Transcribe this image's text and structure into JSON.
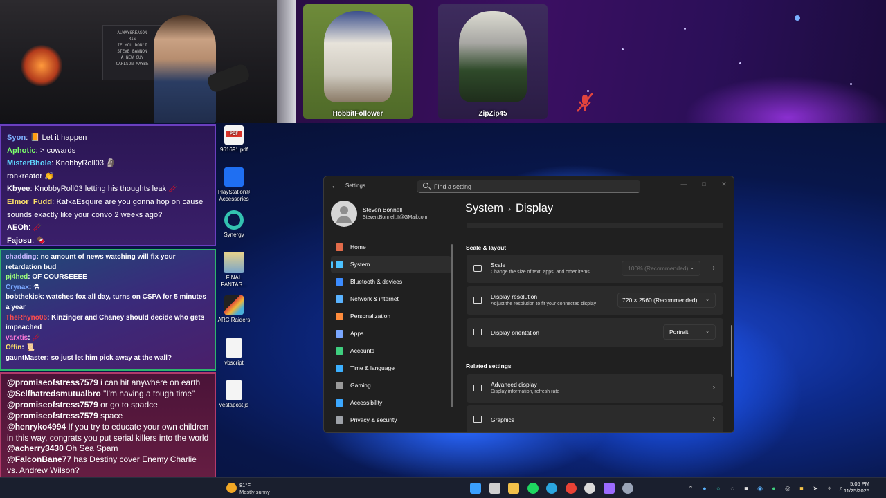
{
  "stream": {
    "webcam_sign_lines": [
      "ALWAYSREASON",
      "RIS",
      "IF YOU DON'T",
      "STEVE BANNON",
      "A NEW GUY",
      "CARLSON MAYBE"
    ],
    "call_participants": [
      {
        "name": "HobbitFollower"
      },
      {
        "name": "ZipZip45",
        "muted": true
      }
    ]
  },
  "chat_panel_1": [
    {
      "user": "Syon",
      "user_color": "#7fb2ff",
      "text": "📙 Let it happen"
    },
    {
      "user": "Aphotic",
      "user_color": "#7cff6a",
      "text": "> cowards"
    },
    {
      "user": "MisterBhole",
      "user_color": "#5fd7ff",
      "text": "KnobbyRoll03 🗿"
    },
    {
      "user": "",
      "user_color": "#ffffff",
      "text": "ronkreator 👏"
    },
    {
      "user": "Kbyee",
      "user_color": "#ffffff",
      "text": "KnobbyRoll03 letting his thoughts leak 🥢"
    },
    {
      "user": "Elmor_Fudd",
      "user_color": "#ffe36a",
      "text": "KafkaEsquire are you gonna hop on cause"
    },
    {
      "user": "",
      "user_color": "#ffffff",
      "text": "sounds exactly like your convo 2 weeks ago?"
    },
    {
      "user": "AEOh",
      "user_color": "#ffffff",
      "text": "🥢"
    },
    {
      "user": "Fajosu",
      "user_color": "#ffffff",
      "text": "🍫"
    }
  ],
  "chat_panel_2": [
    {
      "user": "chadding",
      "user_color": "#c8b6ff",
      "text": "no amount of news watching will fix your retardation bud"
    },
    {
      "user": "pj4hed",
      "user_color": "#9cff7a",
      "text": "OF COURSEEEE"
    },
    {
      "user": "Crynax",
      "user_color": "#7aa8ff",
      "text": "⚗"
    },
    {
      "user": "bobthekick",
      "user_color": "#ffffff",
      "text": "watches fox all day, turns on CSPA for 5 minutes a year"
    },
    {
      "user": "TheRhyno06",
      "user_color": "#ff4d4d",
      "text": "Kinzinger and Chaney should decide who gets impeached"
    },
    {
      "user": "varxtis",
      "user_color": "#ff7ad9",
      "text": "🥢"
    },
    {
      "user": "Offin",
      "user_color": "#ffe36a",
      "text": "📜"
    },
    {
      "user": "gauntMaster",
      "user_color": "#ffffff",
      "text": "so just let him pick away at the wall?"
    }
  ],
  "chat_panel_3": [
    {
      "user": "@promiseofstress7579",
      "text": "i can hit anywhere on earth"
    },
    {
      "user": "@Selfhatredsmutualbro",
      "text": "\"I'm having a tough time\""
    },
    {
      "user": "@promiseofstress7579",
      "text": "or go to spadce"
    },
    {
      "user": "@promiseofstress7579",
      "text": "space"
    },
    {
      "user": "@henryko4994",
      "text": "If you try to educate your own children in this way, congrats you put serial killers into the world"
    },
    {
      "user": "@acherry3430",
      "text": "Oh Sea Spam"
    },
    {
      "user": "@FalconBane77",
      "text": "has Destiny cover Enemy Charlie vs. Andrew Wilson?"
    }
  ],
  "desktop_icons": [
    {
      "label": "961691.pdf",
      "icon": "pdf-file-icon"
    },
    {
      "label": "PlayStation® Accessories",
      "icon": "playstation-icon"
    },
    {
      "label": "Synergy",
      "icon": "synergy-icon"
    },
    {
      "label": "FINAL FANTAS...",
      "icon": "final-fantasy-icon"
    },
    {
      "label": "ARC Raiders",
      "icon": "arc-raiders-icon"
    },
    {
      "label": "vbscript",
      "icon": "file-icon"
    },
    {
      "label": "vestapost.js",
      "icon": "file-icon"
    }
  ],
  "settings": {
    "app_title": "Settings",
    "search_placeholder": "Find a setting",
    "user_name": "Steven Bonnell",
    "user_email": "Steven.Bonnell.II@GMail.com",
    "breadcrumb_parent": "System",
    "breadcrumb_current": "Display",
    "nav": [
      {
        "label": "Home",
        "icon": "home-icon",
        "color": "#e26b4a",
        "active": false
      },
      {
        "label": "System",
        "icon": "monitor-icon",
        "color": "#4cc2ff",
        "active": true
      },
      {
        "label": "Bluetooth & devices",
        "icon": "bluetooth-icon",
        "color": "#3c8cff",
        "active": false
      },
      {
        "label": "Network & internet",
        "icon": "wifi-icon",
        "color": "#5ab3ff",
        "active": false
      },
      {
        "label": "Personalization",
        "icon": "brush-icon",
        "color": "#ff8c3c",
        "active": false
      },
      {
        "label": "Apps",
        "icon": "apps-icon",
        "color": "#7aa7ff",
        "active": false
      },
      {
        "label": "Accounts",
        "icon": "person-icon",
        "color": "#3fcf7f",
        "active": false
      },
      {
        "label": "Time & language",
        "icon": "globe-clock-icon",
        "color": "#3cb0ff",
        "active": false
      },
      {
        "label": "Gaming",
        "icon": "controller-icon",
        "color": "#9a9a9a",
        "active": false
      },
      {
        "label": "Accessibility",
        "icon": "accessibility-icon",
        "color": "#3ca8ff",
        "active": false
      },
      {
        "label": "Privacy & security",
        "icon": "shield-icon",
        "color": "#9ea2a8",
        "active": false
      }
    ],
    "scale_layout_heading": "Scale & layout",
    "scale_title": "Scale",
    "scale_subtitle": "Change the size of text, apps, and other items",
    "scale_value": "100% (Recommended)",
    "resolution_title": "Display resolution",
    "resolution_subtitle": "Adjust the resolution to fit your connected display",
    "resolution_value": "720 × 2560 (Recommended)",
    "orientation_title": "Display orientation",
    "orientation_value": "Portrait",
    "related_heading": "Related settings",
    "advanced_title": "Advanced display",
    "advanced_subtitle": "Display information, refresh rate",
    "graphics_title": "Graphics"
  },
  "taskbar": {
    "weather_temp": "81°F",
    "weather_desc": "Mostly sunny",
    "time": "5:05 PM",
    "date": "11/25/2025",
    "apps": [
      {
        "name": "start-icon",
        "color": "#3aa0ff"
      },
      {
        "name": "task-view-icon",
        "color": "#cfcfcf"
      },
      {
        "name": "file-explorer-icon",
        "color": "#f2c14a"
      },
      {
        "name": "spotify-icon",
        "color": "#1ed760"
      },
      {
        "name": "edge-icon",
        "color": "#2aa6e0"
      },
      {
        "name": "chrome-icon",
        "color": "#e94235"
      },
      {
        "name": "obs-icon",
        "color": "#d9d9d9"
      },
      {
        "name": "app-icon",
        "color": "#9b6bff"
      },
      {
        "name": "settings-icon",
        "color": "#9aa4b8"
      }
    ]
  }
}
